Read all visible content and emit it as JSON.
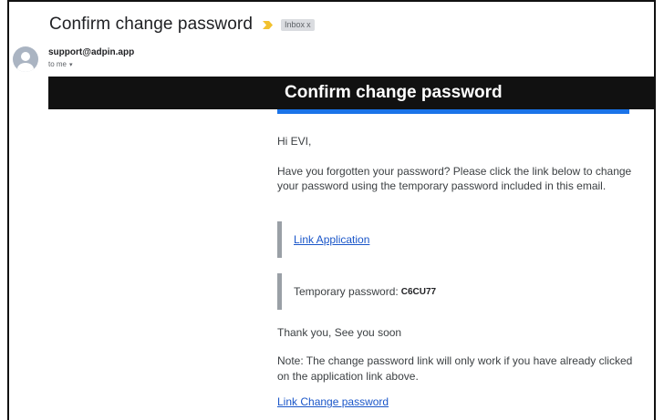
{
  "email": {
    "subject": "Confirm change password",
    "label_chip": "Inbox",
    "label_chip_close": "x",
    "sender": "support@adpin.app",
    "recipient": "to me",
    "recipient_caret": "▾"
  },
  "body": {
    "banner_title": "Confirm change password",
    "greeting": "Hi EVI,",
    "intro": "Have you forgotten your password? Please click the link below to change your password using the temporary password included in this email.",
    "app_link": "Link Application",
    "temp_password_label": "Temporary password:",
    "temp_password_value": "C6CU77",
    "thanks": "Thank you, See you soon",
    "note": "Note: The change password link will only work if you have already clicked on the application link above.",
    "change_link": "Link Change password"
  },
  "colors": {
    "banner_bg": "#111111",
    "accent_blue": "#1a73e8",
    "link": "#1a56c9",
    "important_marker": "#f2c12e"
  },
  "icons": {
    "important": "important-marker-icon",
    "avatar": "default-avatar-icon"
  }
}
